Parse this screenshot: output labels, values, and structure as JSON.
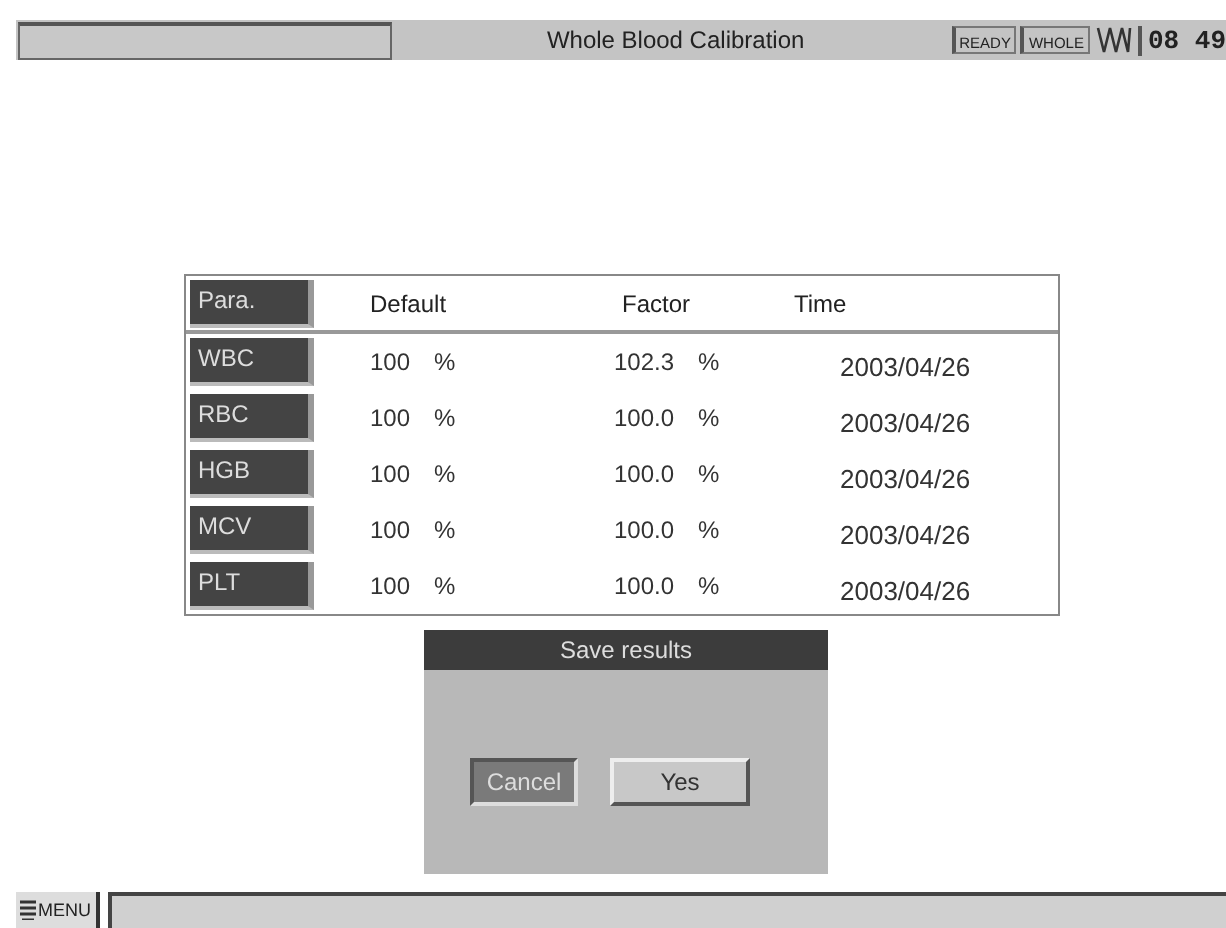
{
  "title_bar": {
    "title": "Whole Blood Calibration",
    "status": [
      "READY",
      "WHOLE"
    ],
    "time": "08 49"
  },
  "table": {
    "columns": [
      "Para.",
      "Default",
      "Factor",
      "Time"
    ],
    "rows": [
      {
        "param": "WBC",
        "default": "100",
        "default_unit": "%",
        "factor": "102.3",
        "factor_unit": "%",
        "time": "2003/04/26"
      },
      {
        "param": "RBC",
        "default": "100",
        "default_unit": "%",
        "factor": "100.0",
        "factor_unit": "%",
        "time": "2003/04/26"
      },
      {
        "param": "HGB",
        "default": "100",
        "default_unit": "%",
        "factor": "100.0",
        "factor_unit": "%",
        "time": "2003/04/26"
      },
      {
        "param": "MCV",
        "default": "100",
        "default_unit": "%",
        "factor": "100.0",
        "factor_unit": "%",
        "time": "2003/04/26"
      },
      {
        "param": "PLT",
        "default": "100",
        "default_unit": "%",
        "factor": "100.0",
        "factor_unit": "%",
        "time": "2003/04/26"
      }
    ]
  },
  "dialog": {
    "title": "Save results",
    "buttons": [
      {
        "label": "Cancel",
        "selected": true
      },
      {
        "label": "Yes",
        "selected": false
      }
    ]
  },
  "bottom_bar": {
    "menu": "MENU"
  }
}
